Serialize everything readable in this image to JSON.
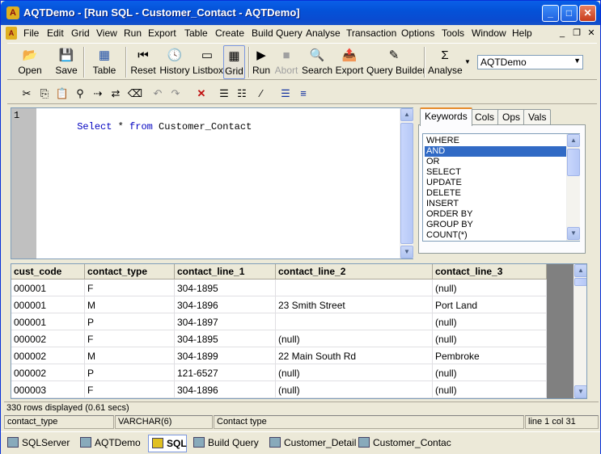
{
  "window": {
    "title": "AQTDemo - [Run SQL - Customer_Contact - AQTDemo]",
    "app_icon": "aqt-logo-icon"
  },
  "menu": [
    "File",
    "Edit",
    "Grid",
    "View",
    "Run",
    "Export",
    "Table",
    "Create",
    "Build Query",
    "Analyse",
    "Transaction",
    "Options",
    "Tools",
    "Window",
    "Help"
  ],
  "toolbar": {
    "open": "Open",
    "save": "Save",
    "table": "Table",
    "reset": "Reset",
    "history": "History",
    "listbox": "Listbox",
    "grid": "Grid",
    "run": "Run",
    "abort": "Abort",
    "search": "Search",
    "export": "Export",
    "query_builder": "Query Builder",
    "analyse": "Analyse",
    "connection": "AQTDemo"
  },
  "editor": {
    "line_number": "1",
    "tokens": [
      {
        "t": "Select",
        "kw": true
      },
      {
        "t": " * ",
        "kw": false
      },
      {
        "t": "from",
        "kw": true
      },
      {
        "t": " Customer_Contact",
        "kw": false
      }
    ]
  },
  "side_tabs": [
    "Keywords",
    "Cols",
    "Ops",
    "Vals"
  ],
  "keywords": [
    "WHERE",
    "AND",
    "OR",
    "SELECT",
    "UPDATE",
    "DELETE",
    "INSERT",
    "ORDER BY",
    "GROUP BY",
    "COUNT(*)"
  ],
  "keywords_selected": 1,
  "grid": {
    "columns": [
      "cust_code",
      "contact_type",
      "contact_line_1",
      "contact_line_2",
      "contact_line_3"
    ],
    "rows": [
      [
        "000001",
        "F",
        "304-1895",
        "",
        "(null)"
      ],
      [
        "000001",
        "M",
        "304-1896",
        "23 Smith Street",
        "Port Land"
      ],
      [
        "000001",
        "P",
        "304-1897",
        "",
        "(null)"
      ],
      [
        "000002",
        "F",
        "304-1895",
        "(null)",
        "(null)"
      ],
      [
        "000002",
        "M",
        "304-1899",
        "22 Main South Rd",
        "Pembroke"
      ],
      [
        "000002",
        "P",
        "121-6527",
        "(null)",
        "(null)"
      ],
      [
        "000003",
        "F",
        "304-1896",
        "(null)",
        "(null)"
      ]
    ]
  },
  "status": {
    "rows_displayed": "330 rows displayed (0.61 secs)",
    "column_name": "contact_type",
    "column_type": "VARCHAR(6)",
    "column_desc": "Contact type",
    "position": "line  1 col  31"
  },
  "taskbar": [
    "SQLServer",
    "AQTDemo",
    "SQL",
    "Build Query",
    "Customer_Detail",
    "Customer_Contac"
  ],
  "taskbar_selected": 2
}
